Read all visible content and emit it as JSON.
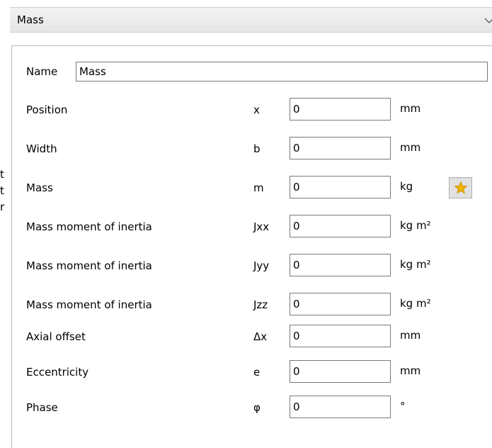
{
  "background_fragments": [
    "t",
    "t",
    "r"
  ],
  "header": {
    "title": "Mass",
    "icon": "chevron-down-icon"
  },
  "form": {
    "name_label": "Name",
    "name_value": "Mass",
    "rows": [
      {
        "label": "Position",
        "symbol": "x",
        "value": "0",
        "unit": "mm"
      },
      {
        "label": "Width",
        "symbol": "b",
        "value": "0",
        "unit": "mm"
      },
      {
        "label": "Mass",
        "symbol": "m",
        "value": "0",
        "unit": "kg"
      },
      {
        "label": "Mass moment of inertia",
        "symbol": "Jxx",
        "value": "0",
        "unit": "kg m²"
      },
      {
        "label": "Mass moment of inertia",
        "symbol": "Jyy",
        "value": "0",
        "unit": "kg m²"
      },
      {
        "label": "Mass moment of inertia",
        "symbol": "Jzz",
        "value": "0",
        "unit": "kg m²"
      },
      {
        "label": "Axial offset",
        "symbol": "Δx",
        "value": "0",
        "unit": "mm"
      },
      {
        "label": "Eccentricity",
        "symbol": "e",
        "value": "0",
        "unit": "mm"
      },
      {
        "label": "Phase",
        "symbol": "φ",
        "value": "0",
        "unit": "°"
      }
    ],
    "star_button_icon": "star-icon",
    "star_color": "#f0b400"
  }
}
